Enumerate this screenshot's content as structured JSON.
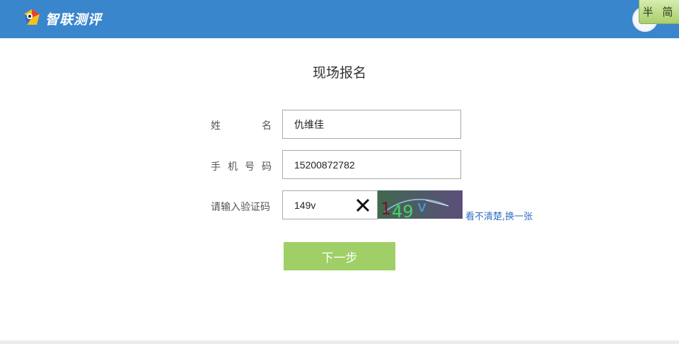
{
  "header": {
    "brand": "智联测评",
    "ime_label": "半 简"
  },
  "form": {
    "title": "现场报名",
    "name_label_chars": [
      "姓",
      "名"
    ],
    "name_value": "仇维佳",
    "phone_label_chars": [
      "手",
      "机",
      "号",
      "码"
    ],
    "phone_value": "15200872782",
    "captcha_label": "请输入验证码",
    "captcha_value": "149v",
    "captcha_image_text": "149 v",
    "refresh_text": "看不清楚,换一张",
    "next_button": "下一步"
  },
  "colors": {
    "topbar": "#3a86cd",
    "button": "#9fcf66",
    "link": "#2f6fbf"
  }
}
